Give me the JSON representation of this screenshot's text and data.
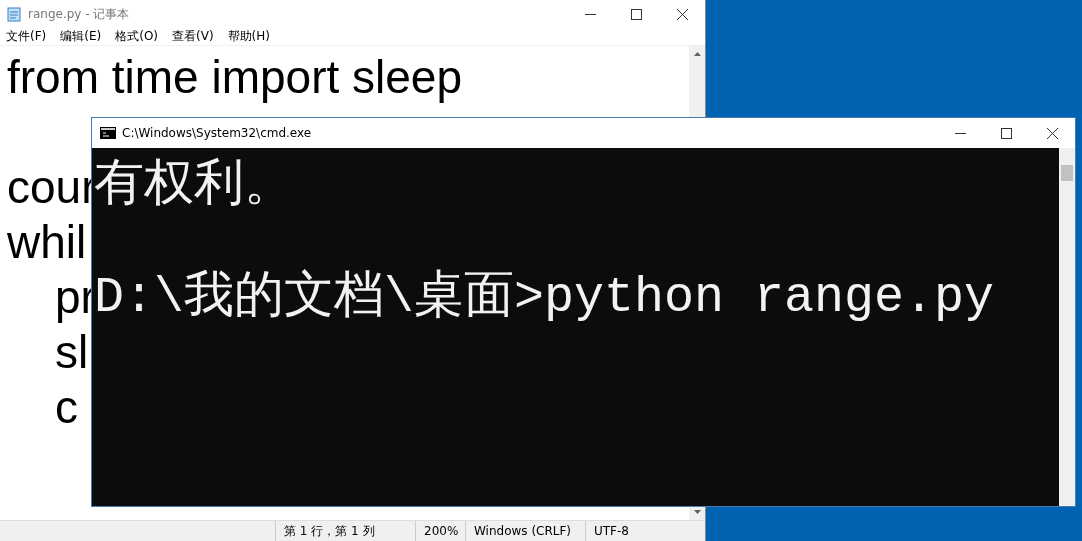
{
  "notepad": {
    "title": "range.py - 记事本",
    "menu": [
      "文件(F)",
      "编辑(E)",
      "格式(O)",
      "查看(V)",
      "帮助(H)"
    ],
    "lines": [
      {
        "text": "from time import sleep",
        "indented": false
      },
      {
        "text": "cour",
        "indented": false
      },
      {
        "text": "whil",
        "indented": false
      },
      {
        "text": "pr",
        "indented": true
      },
      {
        "text": "sl",
        "indented": true
      },
      {
        "text": "c",
        "indented": true
      }
    ],
    "status": [
      "第 1 行，第 1 列",
      "200%",
      "Windows (CRLF)",
      "UTF-8"
    ]
  },
  "console": {
    "title": "C:\\Windows\\System32\\cmd.exe",
    "lines": [
      "有权利。",
      "D:\\我的文档\\桌面>python range.py"
    ]
  }
}
